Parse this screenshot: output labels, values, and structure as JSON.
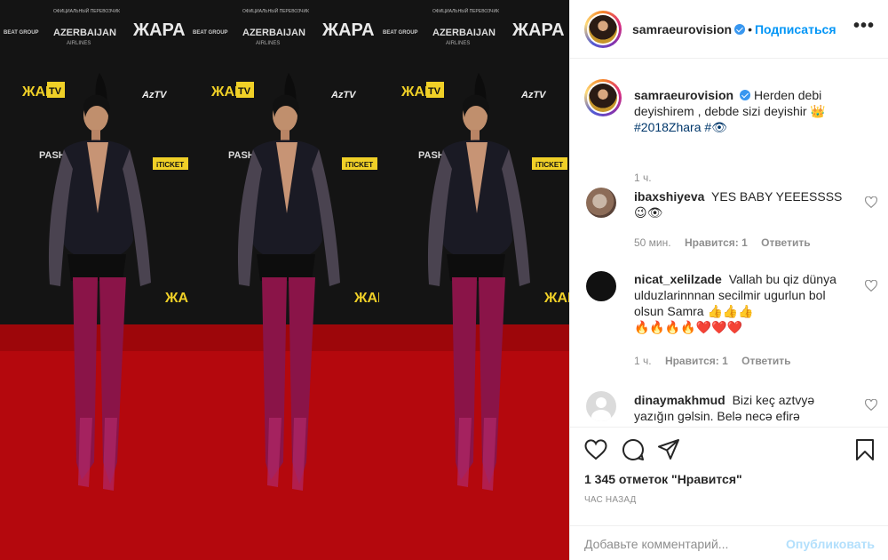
{
  "post": {
    "username": "samraeurovision",
    "follow_label": "Подписаться",
    "more_label": "•••",
    "caption": {
      "username": "samraeurovision",
      "text": "Herden debi deyishirem , debde sizi deyishir 👑",
      "hashtags": "#2018Zhara #👁",
      "time": "1 ч."
    },
    "comments": [
      {
        "username": "ibaxshiyeva",
        "text": "YES BABY YEEESSSS",
        "text2": "😉👁",
        "time": "50 мин.",
        "likes": "Нравится: 1",
        "reply": "Ответить"
      },
      {
        "username": "nicat_xelilzade",
        "text": "Vallah bu qiz dünya ulduzlarinnnan secilmir ugurlun bol olsun Samra 👍👍👍",
        "text2": "🔥🔥🔥🔥❤️❤️❤️",
        "time": "1 ч.",
        "likes": "Нравится: 1",
        "reply": "Ответить"
      },
      {
        "username": "dinaymakhmud",
        "text": "Bizi keç aztvyə yazığın gəlsin. Belə necə efirə"
      }
    ],
    "likes_count": "1 345 отметок \"Нравится\"",
    "posted_ago": "ЧАС НАЗАД",
    "add_comment_placeholder": "Добавьте комментарий...",
    "publish_label": "Опубликовать"
  },
  "backdrop": {
    "sponsor_small": "ОФИЦИАЛЬНЫЙ ПЕРЕВОЗЧИК",
    "sponsor_main": "AZERBAIJAN",
    "sponsor_sub": "AIRLINES",
    "beat": "BEAT GROUP",
    "zhara": "ЖАРА",
    "tv": "TV",
    "aztv": "AzTV",
    "pasha": "PASHA",
    "iticket": "iTICKET"
  },
  "colors": {
    "accent": "#0095f6",
    "carpet": "#b4080d",
    "backdrop": "#141414",
    "boots": "#8a1448"
  }
}
